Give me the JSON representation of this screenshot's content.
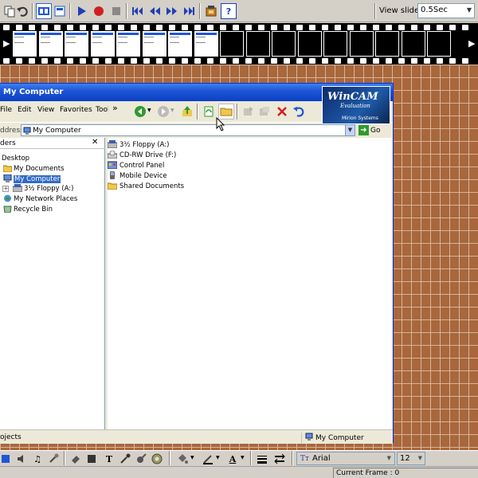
{
  "toolbar": {
    "view_slide_label": "View slide",
    "view_slide_value": "0.5Sec",
    "help_label": "?"
  },
  "explorer": {
    "title": "My Computer",
    "menu": [
      "File",
      "Edit",
      "View",
      "Favorites",
      "Tools"
    ],
    "menu_overflow": "»",
    "address_label": "ddress",
    "address_value": "My Computer",
    "go_label": "Go",
    "folders": {
      "title": "ders",
      "close_glyph": "✕",
      "items": [
        {
          "label": "Desktop"
        },
        {
          "label": "My Documents"
        },
        {
          "label": "My Computer"
        },
        {
          "label": "3½ Floppy (A:)"
        },
        {
          "label": "My Network Places"
        },
        {
          "label": "Recycle Bin"
        }
      ]
    },
    "content_items": [
      {
        "label": "3½ Floppy (A:)",
        "icon": "floppy-drive-icon"
      },
      {
        "label": "CD-RW Drive (F:)",
        "icon": "cd-drive-icon"
      },
      {
        "label": "Control Panel",
        "icon": "control-panel-icon"
      },
      {
        "label": "Mobile Device",
        "icon": "mobile-device-icon"
      },
      {
        "label": "Shared Documents",
        "icon": "folder-icon"
      }
    ],
    "status_left": "ojects",
    "status_right": "My Computer"
  },
  "watermark": {
    "title": "WinCAM",
    "subtitle": "Evaluation",
    "vendor": "Mirion Systems"
  },
  "bottom_toolbar": {
    "font_name": "Arial",
    "font_size": "12",
    "text_tool": "T"
  },
  "app_status": {
    "current_frame": "Current Frame : 0"
  },
  "colors": {
    "titlebar": "#1f56d8",
    "brick": "#a8673c",
    "selection": "#316ac5"
  }
}
